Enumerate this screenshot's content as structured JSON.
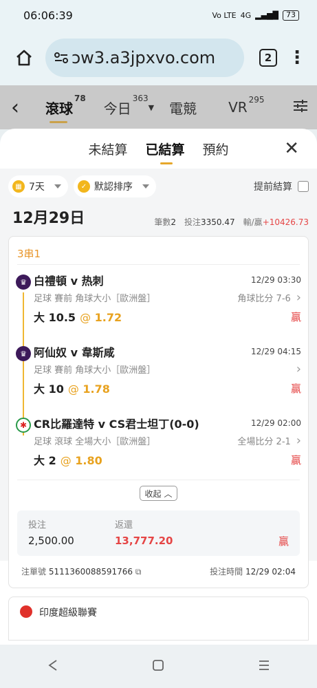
{
  "status": {
    "time": "06:06:39",
    "network": "4G",
    "battery": "73"
  },
  "browser": {
    "url": "ɔw3.a3jpxvo.com",
    "tab_count": "2"
  },
  "nav": {
    "tabs": [
      {
        "label": "滾球",
        "badge": "78"
      },
      {
        "label": "今日",
        "badge": "363"
      },
      {
        "label": "電競",
        "badge": ""
      },
      {
        "label": "VR",
        "badge": "295"
      }
    ]
  },
  "sheet": {
    "tabs": [
      "未結算",
      "已結算",
      "預約"
    ],
    "filters": {
      "range": "7天",
      "sort": "默認排序",
      "early_settle": "提前結算"
    }
  },
  "day": {
    "date": "12月29日",
    "count_label": "筆數",
    "count": "2",
    "stake_label": "投注",
    "stake": "3350.47",
    "winloss_label": "輸/贏",
    "winloss": "+10426.73"
  },
  "bet": {
    "type": "3串1",
    "legs": [
      {
        "match": "白禮頓 v 热刺",
        "time": "12/29 03:30",
        "info": "足球 賽前  角球大小［歐洲盤］",
        "score": "角球比分 7-6",
        "selection": "大 10.5",
        "odds_at": "@",
        "odds": "1.72",
        "result": "贏",
        "icon": "EPL"
      },
      {
        "match": "阿仙奴 v 韋斯咸",
        "time": "12/29 04:15",
        "info": "足球 賽前  角球大小［歐洲盤］",
        "score": "",
        "selection": "大 10",
        "odds_at": "@",
        "odds": "1.78",
        "result": "贏",
        "icon": "EPL"
      },
      {
        "match": "CR比羅達特 v CS君士坦丁(0-0)",
        "time": "12/29 02:00",
        "info": "足球 滾球  全場大小［歐洲盤］",
        "score": "全場比分 2-1",
        "selection": "大 2",
        "odds_at": "@",
        "odds": "1.80",
        "result": "贏",
        "icon": "CR"
      }
    ],
    "collapse_label": "收起",
    "stake_label": "投注",
    "stake": "2,500.00",
    "return_label": "返還",
    "return": "13,777.20",
    "result": "贏",
    "ticket_label": "注單號",
    "ticket_no": "5111360088591766",
    "bet_time_label": "投注時間",
    "bet_time": "12/29 02:04"
  },
  "next_card": {
    "league": "印度超級聯賽"
  }
}
